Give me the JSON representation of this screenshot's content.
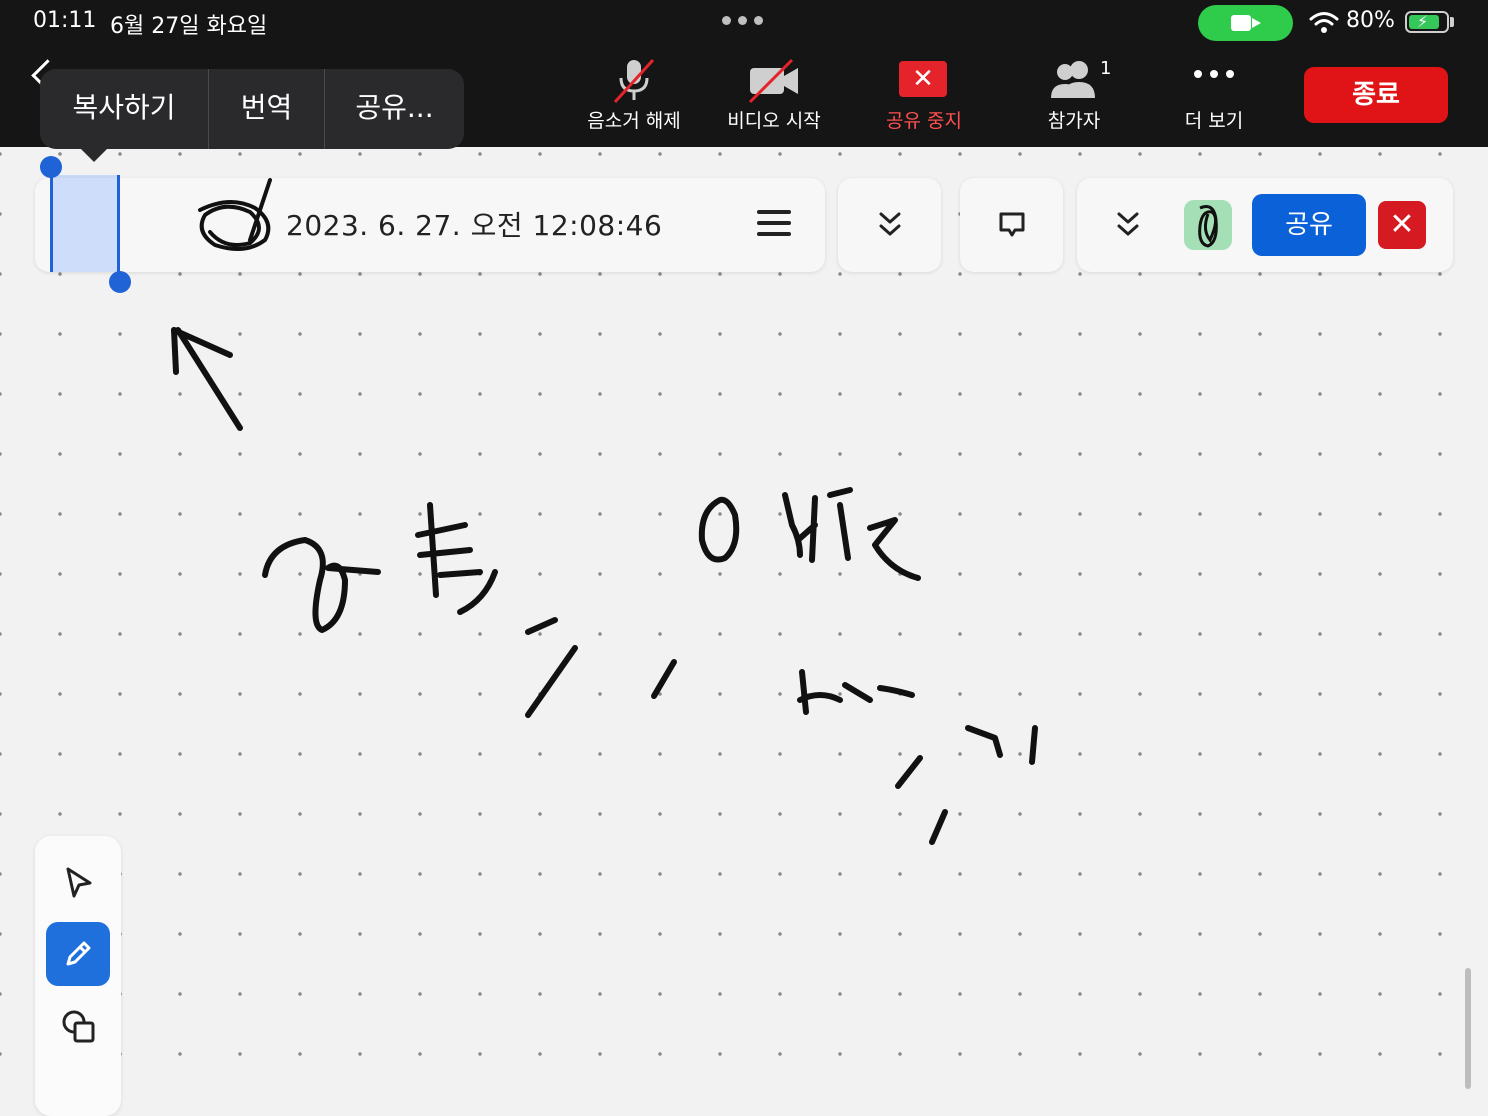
{
  "status_bar": {
    "time": "01:11",
    "date": "6월 27일 화요일",
    "battery": "80%"
  },
  "toolbar": {
    "unmute_label": "음소거 해제",
    "video_label": "비디오 시작",
    "stop_share_label": "공유 중지",
    "participants_label": "참가자",
    "participants_count": "1",
    "more_label": "더 보기",
    "end_label": "종료"
  },
  "context_menu": {
    "items": [
      "복사하기",
      "번역",
      "공유..."
    ]
  },
  "whiteboard": {
    "title": "2023. 6. 27. 오전 12:08:46",
    "share_label": "공유",
    "close_symbol": "✕"
  },
  "icons": {
    "mic": "mic-off-icon",
    "video": "video-off-icon",
    "participants": "people-icon",
    "more": "more-icon",
    "menu": "hamburger-icon",
    "chevrons": "double-chevron-down-icon",
    "comment": "comment-icon",
    "select": "pointer-icon",
    "pen": "pen-icon",
    "shapes": "shapes-icon"
  },
  "colors": {
    "end_red": "#e01316",
    "share_blue": "#0b61d8",
    "selection_blue": "#1f63d6",
    "facetime_green": "#2fcb4b"
  }
}
